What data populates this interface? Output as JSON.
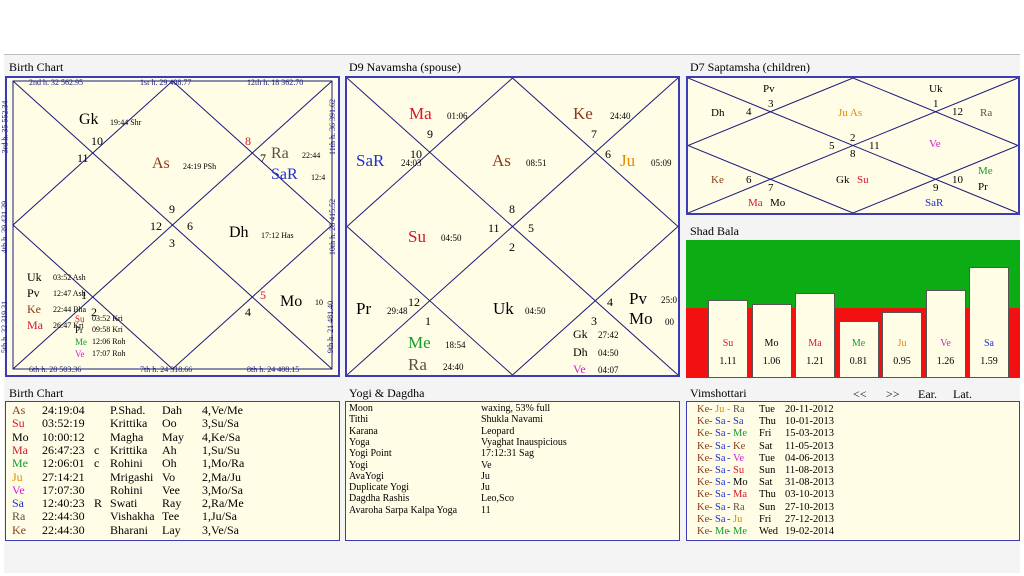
{
  "colors": {
    "blue": "#1f2fd1",
    "brown": "#8b3a1a",
    "red": "#d8142b",
    "green": "#159a2e",
    "orange": "#e08a00",
    "magenta": "#d21fd2",
    "black": "#000000",
    "slate": "#5b4f46",
    "tan": "#7d5a2e"
  },
  "birth_chart": {
    "title": "Birth Chart",
    "top_labels": [
      "2nd h.  32  562.95",
      "1st h.  29  408.77",
      "12th h.  18  362.70"
    ],
    "bottom_labels": [
      "6th h.  28  503.36",
      "7th h.  24  318.66",
      "8th h.  24  408.15"
    ],
    "left_labels": [
      "3rd h.  35  552.34",
      "4th h.  39  431.39",
      "5th h.  32  319.31"
    ],
    "right_labels": [
      "11th h.  36  391.62",
      "10th h.  28  415.52",
      "9th h.  21  481.40"
    ],
    "numbers": [
      "10",
      "11",
      "8",
      "7",
      "9",
      "12",
      "6",
      "3",
      "1",
      "2",
      "5",
      "4"
    ],
    "gk": "Gk",
    "gk_deg": "19:44  Shr",
    "as": "As",
    "as_deg": "24:19  PSh",
    "ra": "Ra",
    "ra_deg": "22:44",
    "sar": "SaR",
    "sar_deg": "12:4",
    "dh": "Dh",
    "dh_deg": "17:12  Has",
    "mo": "Mo",
    "mo_deg": "10",
    "uk": "Uk",
    "uk_deg": "03:52  Ash",
    "pv": "Pv",
    "pv_deg": "12:47  Ash",
    "ke": "Ke",
    "ke_deg": "22:44  Bha",
    "ma": "Ma",
    "ma_deg": "26:47  Kri",
    "su": "Su",
    "su_deg": "03:52  Kri",
    "pr": "Pr",
    "pr_deg": "09:58  Kri",
    "me": "Me",
    "me_deg": "12:06  Roh",
    "ve": "Ve",
    "ve_deg": "17:07  Roh"
  },
  "d9": {
    "title": "D9 Navamsha  (spouse)",
    "numbers": [
      "9",
      "10",
      "7",
      "6",
      "8",
      "11",
      "5",
      "2",
      "12",
      "1",
      "4",
      "3"
    ],
    "ma": "Ma",
    "ma_deg": "01:06",
    "ke": "Ke",
    "ke_deg": "24:40",
    "sar": "SaR",
    "sar_deg": "24:03",
    "as": "As",
    "as_deg": "08:51",
    "ju": "Ju",
    "ju_deg": "05:09",
    "su": "Su",
    "su_deg": "04:50",
    "uk": "Uk",
    "uk_deg": "04:50",
    "pr": "Pr",
    "pr_deg": "29:48",
    "pv": "Pv",
    "pv_deg": "25:0",
    "mo": "Mo",
    "mo_deg": "00",
    "me": "Me",
    "me_deg": "18:54",
    "ra": "Ra",
    "ra_deg": "24:40",
    "gk": "Gk",
    "gk_deg": "27:42",
    "dh": "Dh",
    "dh_deg": "04:50",
    "ve": "Ve",
    "ve_deg": "04:07"
  },
  "d7": {
    "title": "D7 Saptamsha  (children)",
    "numbers": [
      "3",
      "1",
      "4",
      "12",
      "2",
      "5",
      "11",
      "8",
      "6",
      "10",
      "7",
      "9"
    ],
    "pv": "Pv",
    "uk": "Uk",
    "dh": "Dh",
    "ju_as": "Ju As",
    "ra": "Ra",
    "ve": "Ve",
    "me": "Me",
    "pr": "Pr",
    "ke": "Ke",
    "gk": "Gk",
    "su": "Su",
    "ma": "Ma",
    "mo": "Mo",
    "sar": "SaR"
  },
  "shad_bala": {
    "title": "Shad Bala",
    "planets": [
      "Su",
      "Mo",
      "Ma",
      "Me",
      "Ju",
      "Ve",
      "Sa"
    ],
    "values": [
      "1.11",
      "1.06",
      "1.21",
      "0.81",
      "0.95",
      "1.26",
      "1.59"
    ],
    "strength": [
      1.11,
      1.06,
      1.21,
      0.81,
      0.95,
      1.26,
      1.59
    ],
    "label_colors": [
      "#d8142b",
      "#000000",
      "#d8142b",
      "#159a2e",
      "#e08a00",
      "#d21fd2",
      "#1f2fd1"
    ]
  },
  "birth_table": {
    "title": "Birth Chart",
    "rows": [
      [
        "As",
        "24:19:04",
        "",
        "P.Shad.",
        "Dah",
        "4,Ve/Me"
      ],
      [
        "Su",
        "03:52:19",
        "",
        "Krittika",
        "Oo",
        "3,Su/Sa"
      ],
      [
        "Mo",
        "10:00:12",
        "",
        "Magha",
        "May",
        "4,Ke/Sa"
      ],
      [
        "Ma",
        "26:47:23",
        "c",
        "Krittika",
        "Ah",
        "1,Su/Su"
      ],
      [
        "Me",
        "12:06:01",
        "c",
        "Rohini",
        "Oh",
        "1,Mo/Ra"
      ],
      [
        "Ju",
        "27:14:21",
        "",
        "Mrigashi",
        "Vo",
        "2,Ma/Ju"
      ],
      [
        "Ve",
        "17:07:30",
        "",
        "Rohini",
        "Vee",
        "3,Mo/Sa"
      ],
      [
        "Sa",
        "12:40:23",
        "R",
        "Swati",
        "Ray",
        "2,Ra/Me"
      ],
      [
        "Ra",
        "22:44:30",
        "",
        "Vishakha",
        "Tee",
        "1,Ju/Sa"
      ],
      [
        "Ke",
        "22:44:30",
        "",
        "Bharani",
        "Lay",
        "3,Ve/Sa"
      ]
    ],
    "row_colors": [
      "#8b3a1a",
      "#d8142b",
      "#000000",
      "#d8142b",
      "#159a2e",
      "#e08a00",
      "#d21fd2",
      "#1f2fd1",
      "#5b4f46",
      "#8b3a1a"
    ]
  },
  "yogi": {
    "title": "Yogi & Dagdha",
    "rows": [
      [
        "Moon",
        "waxing, 53% full"
      ],
      [
        "Tithi",
        "Shukla  Navami"
      ],
      [
        "Karana",
        "Leopard"
      ],
      [
        "Yoga",
        "Vyaghat Inauspicious"
      ],
      [
        "Yogi Point",
        "17:12:31 Sag"
      ],
      [
        "Yogi",
        "Ve"
      ],
      [
        "AvaYogi",
        "Ju"
      ],
      [
        "Duplicate Yogi",
        "Ju"
      ],
      [
        "Dagdha Rashis",
        "Leo,Sco"
      ],
      [
        "Avaroha Sarpa Kalpa Yoga",
        "11"
      ]
    ]
  },
  "vimshottari": {
    "title": "Vimshottari",
    "nav_prev": "<<",
    "nav_next": ">>",
    "ear": "Ear.",
    "lat": "Lat.",
    "rows": [
      {
        "a": "Ke",
        "b": "Ju",
        "c": "Ra",
        "day": "Tue",
        "date": "20-11-2012"
      },
      {
        "a": "Ke",
        "b": "Sa",
        "c": "Sa",
        "day": "Thu",
        "date": "10-01-2013"
      },
      {
        "a": "Ke",
        "b": "Sa",
        "c": "Me",
        "day": "Fri",
        "date": "15-03-2013"
      },
      {
        "a": "Ke",
        "b": "Sa",
        "c": "Ke",
        "day": "Sat",
        "date": "11-05-2013"
      },
      {
        "a": "Ke",
        "b": "Sa",
        "c": "Ve",
        "day": "Tue",
        "date": "04-06-2013"
      },
      {
        "a": "Ke",
        "b": "Sa",
        "c": "Su",
        "day": "Sun",
        "date": "11-08-2013"
      },
      {
        "a": "Ke",
        "b": "Sa",
        "c": "Mo",
        "day": "Sat",
        "date": "31-08-2013"
      },
      {
        "a": "Ke",
        "b": "Sa",
        "c": "Ma",
        "day": "Thu",
        "date": "03-10-2013"
      },
      {
        "a": "Ke",
        "b": "Sa",
        "c": "Ra",
        "day": "Sun",
        "date": "27-10-2013"
      },
      {
        "a": "Ke",
        "b": "Sa",
        "c": "Ju",
        "day": "Fri",
        "date": "27-12-2013"
      },
      {
        "a": "Ke",
        "b": "Me",
        "c": "Me",
        "day": "Wed",
        "date": "19-02-2014"
      }
    ],
    "planet_colors": {
      "Ke": "#8b3a1a",
      "Ju": "#e08a00",
      "Ra": "#5b4f46",
      "Sa": "#1f2fd1",
      "Me": "#159a2e",
      "Ve": "#d21fd2",
      "Su": "#d8142b",
      "Mo": "#000000",
      "Ma": "#d8142b"
    }
  }
}
